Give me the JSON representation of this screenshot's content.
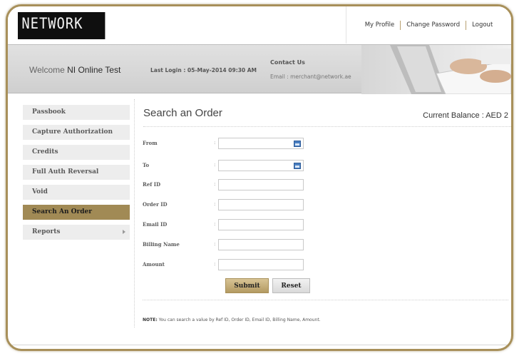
{
  "header": {
    "logo_text": "NETWORK",
    "links": [
      "My Profile",
      "Change Password",
      "Logout"
    ]
  },
  "banner": {
    "welcome_label": "Welcome",
    "welcome_name": "NI Online Test",
    "last_login": "Last Login : 05-May-2014 09:30 AM",
    "contact_title": "Contact Us",
    "contact_email": "Email : merchant@network.ae"
  },
  "sidebar": {
    "items": [
      {
        "label": "Passbook"
      },
      {
        "label": "Capture Authorization"
      },
      {
        "label": "Credits"
      },
      {
        "label": "Full Auth Reversal"
      },
      {
        "label": "Void"
      },
      {
        "label": "Search An Order"
      },
      {
        "label": "Reports"
      }
    ],
    "active_index": 5
  },
  "main": {
    "title": "Search an Order",
    "balance": "Current Balance : AED 2",
    "fields": [
      {
        "label": "From",
        "value": "",
        "calendar": true
      },
      {
        "label": "To",
        "value": "",
        "calendar": true
      },
      {
        "label": "Ref ID",
        "value": ""
      },
      {
        "label": "Order ID",
        "value": ""
      },
      {
        "label": "Email ID",
        "value": ""
      },
      {
        "label": "Billing Name",
        "value": ""
      },
      {
        "label": "Amount",
        "value": ""
      }
    ],
    "colon": ":",
    "submit_label": "Submit",
    "reset_label": "Reset",
    "note_label": "NOTE:",
    "note_text": " You can search a value by Ref ID, Order ID, Email ID, Billing Name, Amount."
  },
  "colors": {
    "accent": "#a18a55",
    "frame": "#a8905a",
    "calendar_icon": "#4a7fc1"
  }
}
